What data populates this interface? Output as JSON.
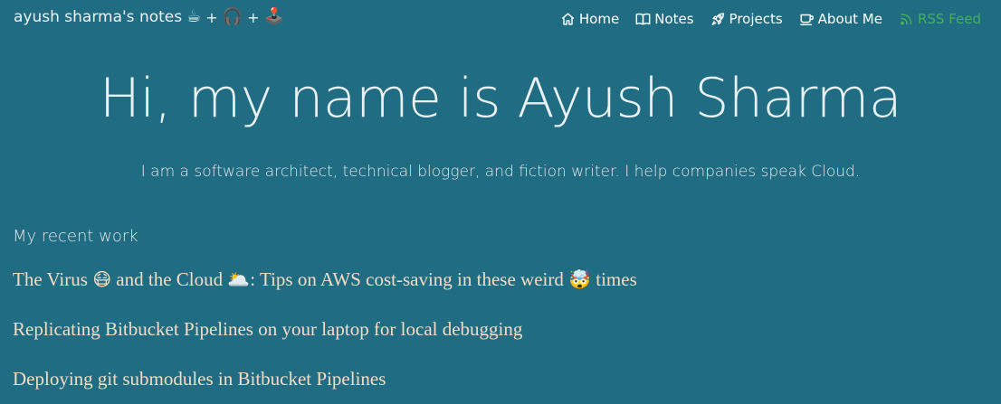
{
  "header": {
    "brand": "ayush sharma's notes",
    "brand_emoji_1": "☕",
    "brand_plus_1": "+",
    "brand_emoji_2": "🎧",
    "brand_plus_2": "+",
    "brand_emoji_3": "🕹️"
  },
  "nav": {
    "items": [
      {
        "label": "Home",
        "icon": "home-icon"
      },
      {
        "label": "Notes",
        "icon": "book-icon"
      },
      {
        "label": "Projects",
        "icon": "rocket-icon"
      },
      {
        "label": "About Me",
        "icon": "coffee-cup-icon"
      },
      {
        "label": "RSS Feed",
        "icon": "rss-icon"
      }
    ],
    "rss_color": "#43b05c"
  },
  "hero": {
    "title": "Hi, my name is Ayush Sharma",
    "subtitle": "I am a software architect, technical blogger, and fiction writer. I help companies speak Cloud."
  },
  "recent": {
    "heading": "My recent work",
    "posts": [
      {
        "part1": "The Virus ",
        "emoji1": "😷",
        "part2": " and the Cloud ",
        "emoji2": "🌥️",
        "part3": ": Tips on AWS cost-saving in these weird ",
        "emoji3": "🤯",
        "part4": " times"
      },
      {
        "title": "Replicating Bitbucket Pipelines on your laptop for local debugging"
      },
      {
        "title": "Deploying git submodules in Bitbucket Pipelines"
      }
    ]
  },
  "colors": {
    "background": "#206c83",
    "link": "#f3dcc3",
    "text": "#e6e6e6"
  }
}
